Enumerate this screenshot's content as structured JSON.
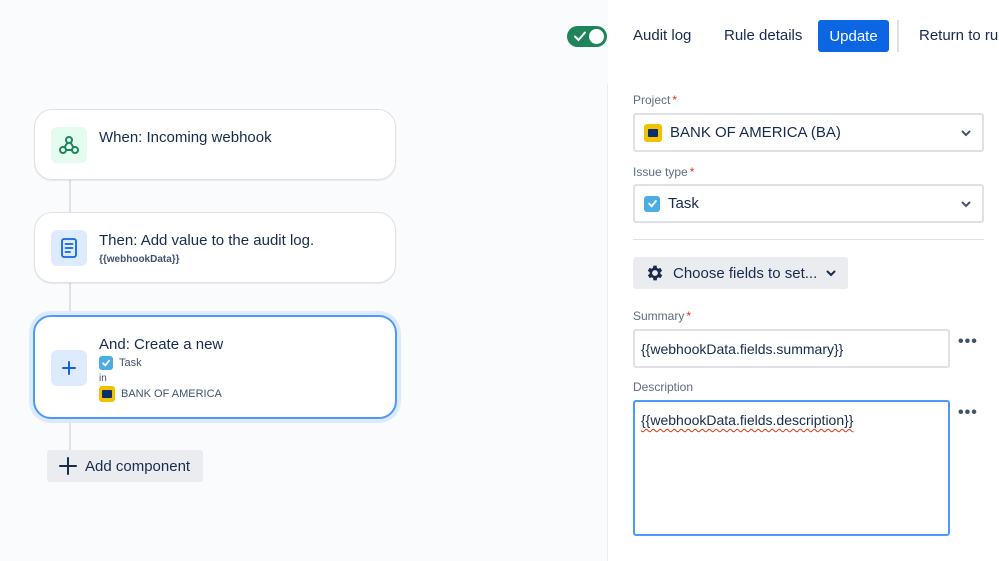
{
  "header": {
    "toggle_state": "on",
    "audit_log": "Audit log",
    "rule_details": "Rule details",
    "update": "Update",
    "return": "Return to rul"
  },
  "flow": {
    "trigger": {
      "title": "When: Incoming webhook",
      "icon": "webhook-icon"
    },
    "action": {
      "title": "Then: Add value to the audit log.",
      "subtitle": "{{webhookData}}",
      "icon": "document-icon"
    },
    "create": {
      "title": "And: Create a new",
      "issue_type": "Task",
      "in_label": "in",
      "project": "BANK OF AMERICA",
      "icon": "plus-icon"
    },
    "add_component": "Add component"
  },
  "panel": {
    "project": {
      "label": "Project",
      "value": "BANK OF AMERICA (BA)"
    },
    "issue_type": {
      "label": "Issue type",
      "value": "Task"
    },
    "choose_fields": "Choose fields to set...",
    "summary": {
      "label": "Summary",
      "value": "{{webhookData.fields.summary}}"
    },
    "description": {
      "label": "Description",
      "value": "{{webhookData.fields.description}}"
    }
  },
  "colors": {
    "primary": "#0c66e4",
    "toggle_on": "#1f845a",
    "selected_border": "#4c9aff",
    "required": "#de350b",
    "task_icon": "#4bade8",
    "project_icon": "#f2c200"
  }
}
